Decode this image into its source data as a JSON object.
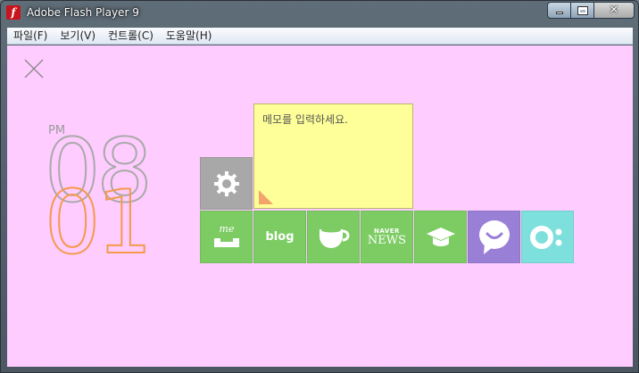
{
  "window": {
    "title": "Adobe Flash Player 9",
    "app_icon_glyph": "f",
    "minimize_glyph": "",
    "close_glyph": "✕"
  },
  "menu": {
    "items": [
      {
        "label": "파일(F)"
      },
      {
        "label": "보기(V)"
      },
      {
        "label": "컨트롤(C)"
      },
      {
        "label": "도움말(H)"
      }
    ]
  },
  "clock": {
    "ampm": "PM",
    "hour": "08",
    "minute": "01"
  },
  "memo": {
    "placeholder": "메모를 입력하세요."
  },
  "tiles": {
    "settings": {
      "icon": "gear-icon"
    },
    "me": {
      "label": "me",
      "icon": "me-inbox-icon"
    },
    "blog": {
      "label": "blog"
    },
    "cafe": {
      "icon": "cup-icon"
    },
    "news": {
      "label_top": "NAVER",
      "label_bottom": "NEWS"
    },
    "school": {
      "icon": "graduation-cap-icon"
    },
    "talk": {
      "icon": "chat-bubble-icon"
    },
    "ndrive": {
      "icon": "ring-colon-icon"
    }
  },
  "colors": {
    "background": "#ffccff",
    "tile_green": "#7ccc63",
    "tile_gray": "#a8a8a8",
    "tile_purple": "#9a7fd6",
    "tile_cyan": "#7ee0dc",
    "memo_yellow": "#ffff99",
    "hour_stroke": "#a9a9a9",
    "minute_stroke": "#f39a4a"
  }
}
